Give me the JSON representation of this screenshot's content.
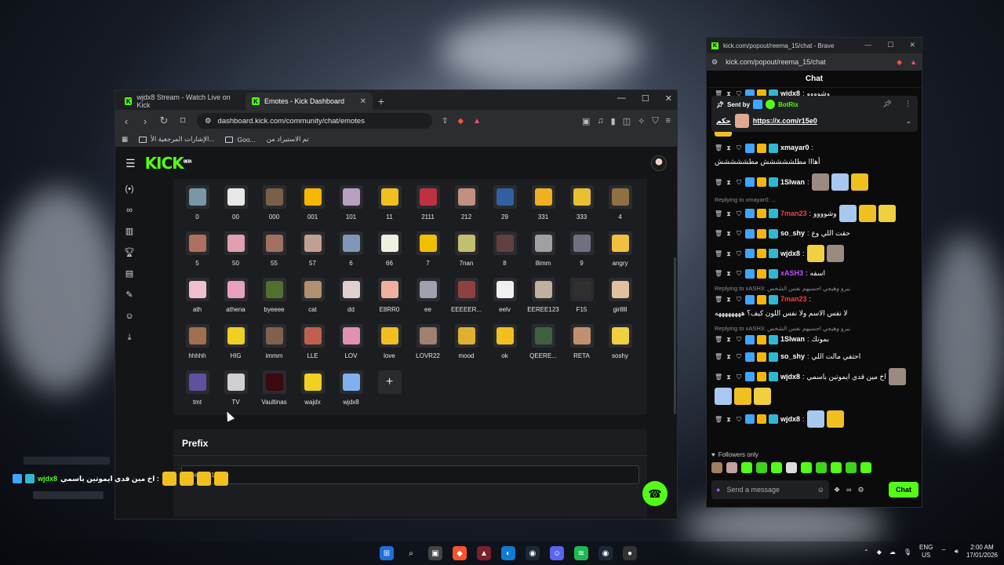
{
  "left_window": {
    "tabs": [
      {
        "label": "wjdx8 Stream - Watch Live on Kick",
        "active": false
      },
      {
        "label": "Emotes - Kick Dashboard",
        "active": true
      }
    ],
    "url": "dashboard.kick.com/community/chat/emotes",
    "bookmarks": [
      "الإشارات المرجعية الأ...",
      "Goo...",
      "تم الاستيراد من"
    ],
    "logo": "KICK",
    "logo_sup": "BETA"
  },
  "emotes": [
    {
      "name": "0",
      "color": "#7a96a8"
    },
    {
      "name": "00",
      "color": "#e8e8e8"
    },
    {
      "name": "000",
      "color": "#7a6048"
    },
    {
      "name": "001",
      "color": "#f5b700"
    },
    {
      "name": "101",
      "color": "#b8a0c0"
    },
    {
      "name": "11",
      "color": "#f0c020"
    },
    {
      "name": "2111",
      "color": "#c03040"
    },
    {
      "name": "212",
      "color": "#c09080"
    },
    {
      "name": "29",
      "color": "#3060a0"
    },
    {
      "name": "331",
      "color": "#f0b020"
    },
    {
      "name": "333",
      "color": "#e8c030"
    },
    {
      "name": "4",
      "color": "#907040"
    },
    {
      "name": "5",
      "color": "#b07060"
    },
    {
      "name": "50",
      "color": "#e0a0b0"
    },
    {
      "name": "55",
      "color": "#a07060"
    },
    {
      "name": "57",
      "color": "#c0a090"
    },
    {
      "name": "6",
      "color": "#8098b8"
    },
    {
      "name": "66",
      "color": "#f0f0e0"
    },
    {
      "name": "7",
      "color": "#f0c000"
    },
    {
      "name": "7nan",
      "color": "#c0c070"
    },
    {
      "name": "8",
      "color": "#604040"
    },
    {
      "name": "8imm",
      "color": "#a0a0a0"
    },
    {
      "name": "9",
      "color": "#707080"
    },
    {
      "name": "angry",
      "color": "#f0c040"
    },
    {
      "name": "ath",
      "color": "#f0c0d0"
    },
    {
      "name": "athena",
      "color": "#e8a0c0"
    },
    {
      "name": "byeeee",
      "color": "#507030"
    },
    {
      "name": "cat",
      "color": "#b09070"
    },
    {
      "name": "dd",
      "color": "#e0d0d0"
    },
    {
      "name": "E8RR0",
      "color": "#f0b0a0"
    },
    {
      "name": "ee",
      "color": "#a0a0b0"
    },
    {
      "name": "EEEEER...",
      "color": "#904040"
    },
    {
      "name": "eelv",
      "color": "#f0f0f0"
    },
    {
      "name": "EEREE123",
      "color": "#c0b0a0"
    },
    {
      "name": "F15",
      "color": "#303030"
    },
    {
      "name": "girlllll",
      "color": "#e0c0a0"
    },
    {
      "name": "hhhhh",
      "color": "#a07050"
    },
    {
      "name": "HIG",
      "color": "#f0d020"
    },
    {
      "name": "immm",
      "color": "#806050"
    },
    {
      "name": "LLE",
      "color": "#c06050"
    },
    {
      "name": "LOV",
      "color": "#e090b0"
    },
    {
      "name": "love",
      "color": "#f0c020"
    },
    {
      "name": "LOVR22",
      "color": "#a08070"
    },
    {
      "name": "mood",
      "color": "#e0b030"
    },
    {
      "name": "ok",
      "color": "#f0c020"
    },
    {
      "name": "QEERE...",
      "color": "#406040"
    },
    {
      "name": "RETA",
      "color": "#c09070"
    },
    {
      "name": "soshy",
      "color": "#f0d040"
    },
    {
      "name": "tmt",
      "color": "#6050a0"
    },
    {
      "name": "TV",
      "color": "#d0d0d0"
    },
    {
      "name": "Vaultinas",
      "color": "#3a0a10"
    },
    {
      "name": "wajdx",
      "color": "#f0d020"
    },
    {
      "name": "wjdx8",
      "color": "#80b0f0"
    }
  ],
  "prefix": {
    "title": "Prefix",
    "value": "reema_15"
  },
  "right_window": {
    "title": "kick.com/popout/reema_15/chat - Brave",
    "url": "kick.com/popout/reema_15/chat",
    "chat_header": "Chat",
    "pinned": {
      "sent_by": "Sent by",
      "sender": "BotRix",
      "prefix_text": "حكم",
      "link": "https://x.com/r15e0"
    },
    "messages": [
      {
        "reply": "",
        "user": "wjdx8",
        "color": "#ffffff",
        "text": "وشوووو",
        "emotes": 0
      },
      {
        "reply": "",
        "user": "xASH3",
        "color": "#c04cff",
        "text": "نيرو وهيجي احسبهم نفس الشخص",
        "emotes": 1
      },
      {
        "reply": "",
        "user": "xmayar0",
        "color": "#ffffff",
        "text": "أهااا مطلششششش مطششششش",
        "emotes": 0
      },
      {
        "reply": "",
        "user": "1Slwan",
        "color": "#ffffff",
        "text": "",
        "emotes": 3
      },
      {
        "reply": "Replying to xmayar0: ...",
        "user": "7man23",
        "color": "#ff3b3b",
        "text": "وشوووو",
        "emotes": 3
      },
      {
        "reply": "",
        "user": "so_shy",
        "color": "#ffffff",
        "text": "حقت اللي وع",
        "emotes": 0
      },
      {
        "reply": "",
        "user": "wjdx8",
        "color": "#ffffff",
        "text": "",
        "emotes": 2
      },
      {
        "reply": "",
        "user": "xASH3",
        "color": "#c04cff",
        "text": "اسفه",
        "emotes": 0
      },
      {
        "reply": "Replying to xASH3: نيرو وهيجي احسبهم نفس الشخص",
        "user": "7man23",
        "color": "#ff3b3b",
        "text": "لا نفس الاسم ولا نفس اللون كيف؟ ههههههههه",
        "emotes": 0
      },
      {
        "reply": "Replying to xASH3: نيرو وهيجي احسبهم نفس الشخص",
        "user": "1Slwan",
        "color": "#ffffff",
        "text": "بموتك",
        "emotes": 0
      },
      {
        "reply": "",
        "user": "so_shy",
        "color": "#ffffff",
        "text": "احتفي مالت اللي",
        "emotes": 0
      },
      {
        "reply": "",
        "user": "wjdx8",
        "color": "#ffffff",
        "text": "اخ مين قدي ايموتين باسمي",
        "emotes": 4
      },
      {
        "reply": "",
        "user": "wjdx8",
        "color": "#ffffff",
        "text": "",
        "emotes": 2
      }
    ],
    "followers_only": "Followers only",
    "send_placeholder": "Send a message",
    "chat_button": "Chat"
  },
  "overlay": {
    "user": "wjdx8",
    "text": "اخ مين قدي ايموتين باسمي :"
  },
  "taskbar": {
    "lang": "ENG",
    "region": "US",
    "time": "2:00 AM",
    "date": "17/01/2026"
  },
  "colors": {
    "kick_green": "#53fc18",
    "panel": "#1c1d20",
    "bg": "#141517"
  }
}
